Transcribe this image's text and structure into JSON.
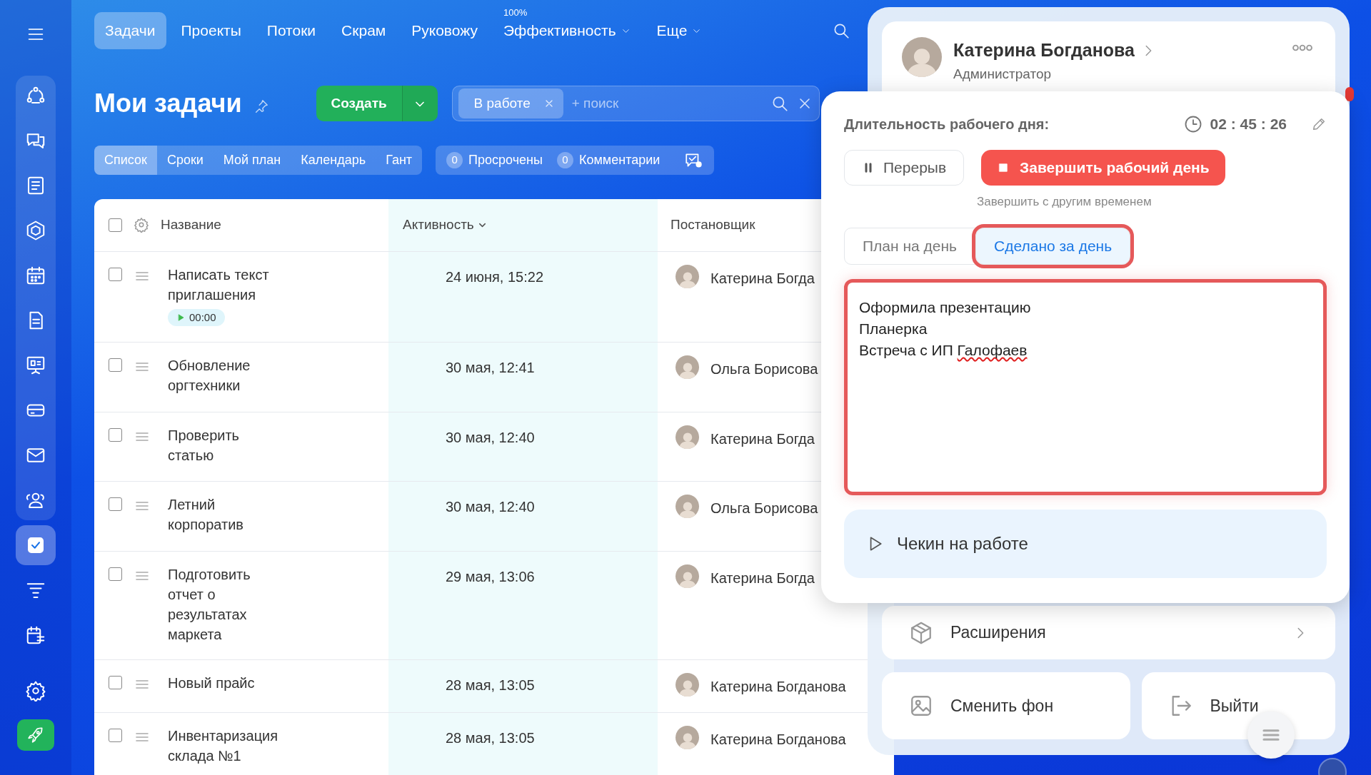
{
  "sidebar": {
    "items": [
      {
        "selected": false
      },
      {
        "selected": false
      },
      {
        "selected": false
      },
      {
        "selected": false
      },
      {
        "selected": false
      },
      {
        "selected": false
      },
      {
        "selected": false
      },
      {
        "selected": false
      },
      {
        "selected": false
      },
      {
        "selected": false
      },
      {
        "selected": true
      },
      {
        "selected": false
      },
      {
        "selected": false
      }
    ]
  },
  "top_nav": {
    "tabs": [
      {
        "label": "Задачи",
        "selected": true,
        "has_menu": false
      },
      {
        "label": "Проекты",
        "selected": false,
        "has_menu": false
      },
      {
        "label": "Потоки",
        "selected": false,
        "has_menu": false
      },
      {
        "label": "Скрам",
        "selected": false,
        "has_menu": false
      },
      {
        "label": "Руковожу",
        "selected": false,
        "has_menu": false
      },
      {
        "label": "Эффективность",
        "selected": false,
        "has_menu": true,
        "badge": "100%"
      },
      {
        "label": "Еще",
        "selected": false,
        "has_menu": true
      }
    ]
  },
  "page": {
    "title": "Мои задачи",
    "create_button": "Создать"
  },
  "filter": {
    "chips": [
      {
        "label": "В работе"
      }
    ],
    "placeholder": "+ поиск"
  },
  "view_tabs": [
    {
      "label": "Список",
      "selected": true
    },
    {
      "label": "Сроки",
      "selected": false
    },
    {
      "label": "Мой план",
      "selected": false
    },
    {
      "label": "Календарь",
      "selected": false
    },
    {
      "label": "Гант",
      "selected": false
    }
  ],
  "counters": [
    {
      "count": "0",
      "label": "Просрочены"
    },
    {
      "count": "0",
      "label": "Комментарии"
    }
  ],
  "table": {
    "all_checked": false,
    "columns": [
      {
        "label": "Название",
        "sortable": false
      },
      {
        "label": "Активность",
        "sortable": true
      },
      {
        "label": "Постановщик",
        "sortable": false
      }
    ],
    "rows": [
      {
        "title": "Написать текст приглашения",
        "timer": "00:00",
        "activity": "24 июня, 15:22",
        "creator": "Катерина Богда",
        "checked": false
      },
      {
        "title": "Обновление оргтехники",
        "activity": "30 мая, 12:41",
        "creator": "Ольга Борисова",
        "checked": false
      },
      {
        "title": "Проверить статью",
        "activity": "30 мая, 12:40",
        "creator": "Катерина Богда",
        "checked": false
      },
      {
        "title": "Летний корпоратив",
        "activity": "30 мая, 12:40",
        "creator": "Ольга Борисова",
        "checked": false
      },
      {
        "title": "Подготовить отчет о результатах маркета",
        "activity": "29 мая, 13:06",
        "creator": "Катерина Богда",
        "checked": false
      },
      {
        "title": "Новый прайс",
        "activity": "28 мая, 13:05",
        "creator": "Катерина Богданова",
        "checked": false
      },
      {
        "title": "Инвентаризация склада №1",
        "activity": "28 мая, 13:05",
        "creator": "Катерина Богданова",
        "checked": false
      }
    ]
  },
  "profile": {
    "name": "Катерина Богданова",
    "role": "Администратор"
  },
  "workday": {
    "title": "Длительность рабочего дня:",
    "duration": "02 : 45 : 26",
    "pause_button": "Перерыв",
    "finish_button": "Завершить рабочий день",
    "finish_other_time": "Завершить с другим временем",
    "tabs": [
      {
        "label": "План на день",
        "selected": false,
        "highlighted": false
      },
      {
        "label": "Сделано за день",
        "selected": true,
        "highlighted": true
      }
    ],
    "report": {
      "highlighted": true,
      "lines": [
        {
          "parts": [
            {
              "text": "Оформила презентацию",
              "misspelled": false
            }
          ]
        },
        {
          "parts": [
            {
              "text": "Планерка",
              "misspelled": false
            }
          ]
        },
        {
          "parts": [
            {
              "text": "Встреча с ИП ",
              "misspelled": false
            },
            {
              "text": "Галофаев",
              "misspelled": true
            }
          ]
        }
      ]
    },
    "checkin_button": "Чекин на работе"
  },
  "menu": {
    "extensions": "Расширения",
    "change_background": "Сменить фон",
    "logout": "Выйти"
  }
}
